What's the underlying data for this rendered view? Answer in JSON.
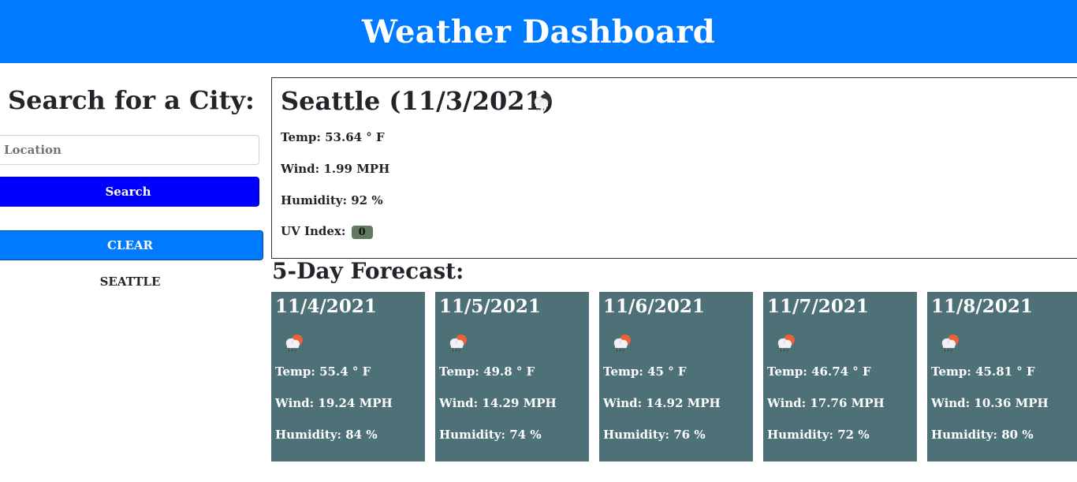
{
  "header": {
    "title": "Weather Dashboard"
  },
  "sidebar": {
    "title": "Search for a City:",
    "search_placeholder": "Location",
    "search_value": "",
    "search_button": "Search",
    "clear_button": "CLEAR",
    "history": [
      "SEATTLE"
    ]
  },
  "current": {
    "title": "Seattle (11/3/2021)",
    "icon": "rain-cloud-icon",
    "temp": "Temp: 53.64 ° F",
    "wind": "Wind: 1.99 MPH",
    "humidity": "Humidity: 92 %",
    "uv_label": "UV Index:",
    "uv_value": "0",
    "uv_color": "#5f7a5f"
  },
  "forecast": {
    "title": "5-Day Forecast:",
    "card_color": "#4d7177",
    "days": [
      {
        "date": "11/4/2021",
        "icon": "sun-behind-rain-cloud-icon",
        "temp": "Temp: 55.4 ° F",
        "wind": "Wind: 19.24 MPH",
        "humidity": "Humidity: 84 %"
      },
      {
        "date": "11/5/2021",
        "icon": "sun-behind-rain-cloud-icon",
        "temp": "Temp: 49.8 ° F",
        "wind": "Wind: 14.29 MPH",
        "humidity": "Humidity: 74 %"
      },
      {
        "date": "11/6/2021",
        "icon": "sun-behind-rain-cloud-icon",
        "temp": "Temp: 45 ° F",
        "wind": "Wind: 14.92 MPH",
        "humidity": "Humidity: 76 %"
      },
      {
        "date": "11/7/2021",
        "icon": "sun-behind-rain-cloud-icon",
        "temp": "Temp: 46.74 ° F",
        "wind": "Wind: 17.76 MPH",
        "humidity": "Humidity: 72 %"
      },
      {
        "date": "11/8/2021",
        "icon": "sun-behind-rain-cloud-icon",
        "temp": "Temp: 45.81 ° F",
        "wind": "Wind: 10.36 MPH",
        "humidity": "Humidity: 80 %"
      }
    ]
  },
  "colors": {
    "header": "#007bff",
    "search_button": "#0000ff",
    "clear_button": "#007bff"
  }
}
